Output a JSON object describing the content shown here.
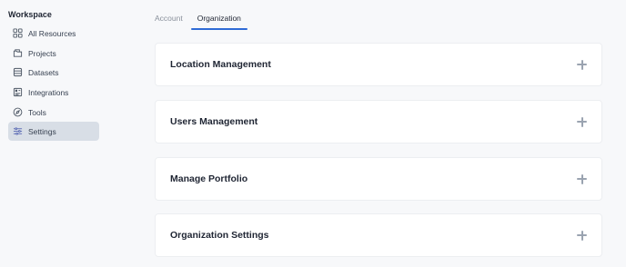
{
  "sidebar": {
    "title": "Workspace",
    "items": [
      {
        "label": "All Resources",
        "icon": "grid-icon",
        "active": false
      },
      {
        "label": "Projects",
        "icon": "folder-icon",
        "active": false
      },
      {
        "label": "Datasets",
        "icon": "database-icon",
        "active": false
      },
      {
        "label": "Integrations",
        "icon": "integrations-icon",
        "active": false
      },
      {
        "label": "Tools",
        "icon": "compass-icon",
        "active": false
      },
      {
        "label": "Settings",
        "icon": "sliders-icon",
        "active": true
      }
    ]
  },
  "tabs": [
    {
      "label": "Account",
      "active": false
    },
    {
      "label": "Organization",
      "active": true
    }
  ],
  "sections": [
    {
      "title": "Location Management",
      "icon": "plus-icon"
    },
    {
      "title": "Users Management",
      "icon": "plus-icon"
    },
    {
      "title": "Manage Portfolio",
      "icon": "plus-icon"
    },
    {
      "title": "Organization Settings",
      "icon": "plus-icon"
    }
  ],
  "colors": {
    "accent": "#2f6bd6",
    "active_nav_bg": "#d8dee6",
    "page_bg": "#f7f8fa"
  }
}
